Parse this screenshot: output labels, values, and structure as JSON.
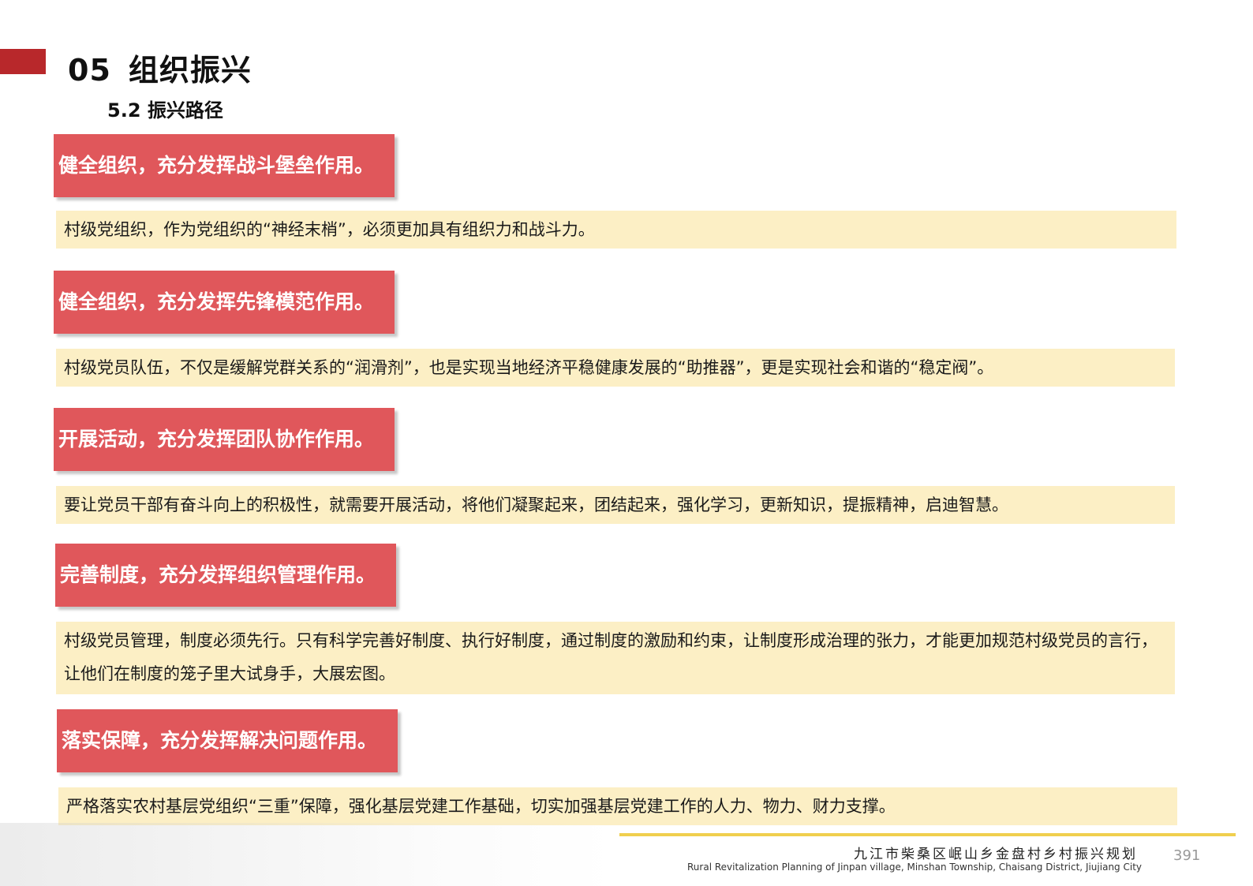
{
  "header": {
    "section_number": "05",
    "section_title": "组织振兴",
    "subsection": "5.2 振兴路径"
  },
  "items": [
    {
      "heading": "健全组织，充分发挥战斗堡垒作用。",
      "text": "村级党组织，作为党组织的“神经末梢”，必须更加具有组织力和战斗力。"
    },
    {
      "heading": "健全组织，充分发挥先锋模范作用。",
      "text": "村级党员队伍，不仅是缓解党群关系的“润滑剂”，也是实现当地经济平稳健康发展的“助推器”，更是实现社会和谐的“稳定阀”。"
    },
    {
      "heading": "开展活动，充分发挥团队协作作用。",
      "text": "要让党员干部有奋斗向上的积极性，就需要开展活动，将他们凝聚起来，团结起来，强化学习，更新知识，提振精神，启迪智慧。"
    },
    {
      "heading": "完善制度，充分发挥组织管理作用。",
      "text": "村级党员管理，制度必须先行。只有科学完善好制度、执行好制度，通过制度的激励和约束，让制度形成治理的张力，才能更加规范村级党员的言行，让他们在制度的笼子里大试身手，大展宏图。"
    },
    {
      "heading": "落实保障，充分发挥解决问题作用。",
      "text": "严格落实农村基层党组织“三重”保障，强化基层党建工作基础，切实加强基层党建工作的人力、物力、财力支撑。"
    }
  ],
  "footer": {
    "title_cn": "九江市柴桑区岷山乡金盘村乡村振兴规划",
    "title_en": "Rural Revitalization Planning of Jinpan village, Minshan Township, Chaisang District, Jiujiang City",
    "page_number": "391"
  },
  "colors": {
    "accent": "#b8282b",
    "heading_bg": "#e0575b",
    "paragraph_bg": "#fcefc5",
    "footer_rule": "#f0cf4e"
  }
}
